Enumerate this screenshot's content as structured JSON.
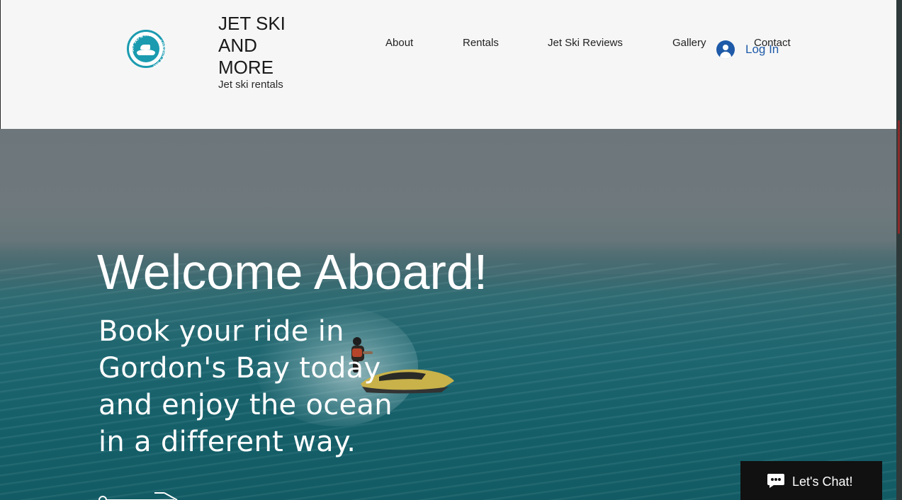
{
  "brand": {
    "title": "JET SKI\nAND\nMORE",
    "subtitle": "Jet ski rentals",
    "logo_ring_text": "JET SKI & MORE · GORDON'S BAY"
  },
  "nav": {
    "items": [
      {
        "label": "About"
      },
      {
        "label": "Rentals"
      },
      {
        "label": "Jet Ski Reviews"
      },
      {
        "label": "Gallery"
      },
      {
        "label": "Contact"
      }
    ]
  },
  "login": {
    "label": "Log In"
  },
  "hero": {
    "title": "Welcome Aboard!",
    "text": "Book your ride  in\nGordon's Bay today\nand enjoy the ocean\nin a different way."
  },
  "chat": {
    "label": "Let's Chat!"
  },
  "colors": {
    "header_bg": "#f6f6f6",
    "brand_teal": "#1a9bb0",
    "login_blue": "#1e5aa8",
    "hero_text": "#ffffff",
    "chat_bg": "#111111"
  },
  "icons": {
    "logo": "jet-ski-logo",
    "login": "user-avatar-icon",
    "chat": "chat-bubble-icon",
    "hero_arrow": "arrow-right-icon"
  }
}
